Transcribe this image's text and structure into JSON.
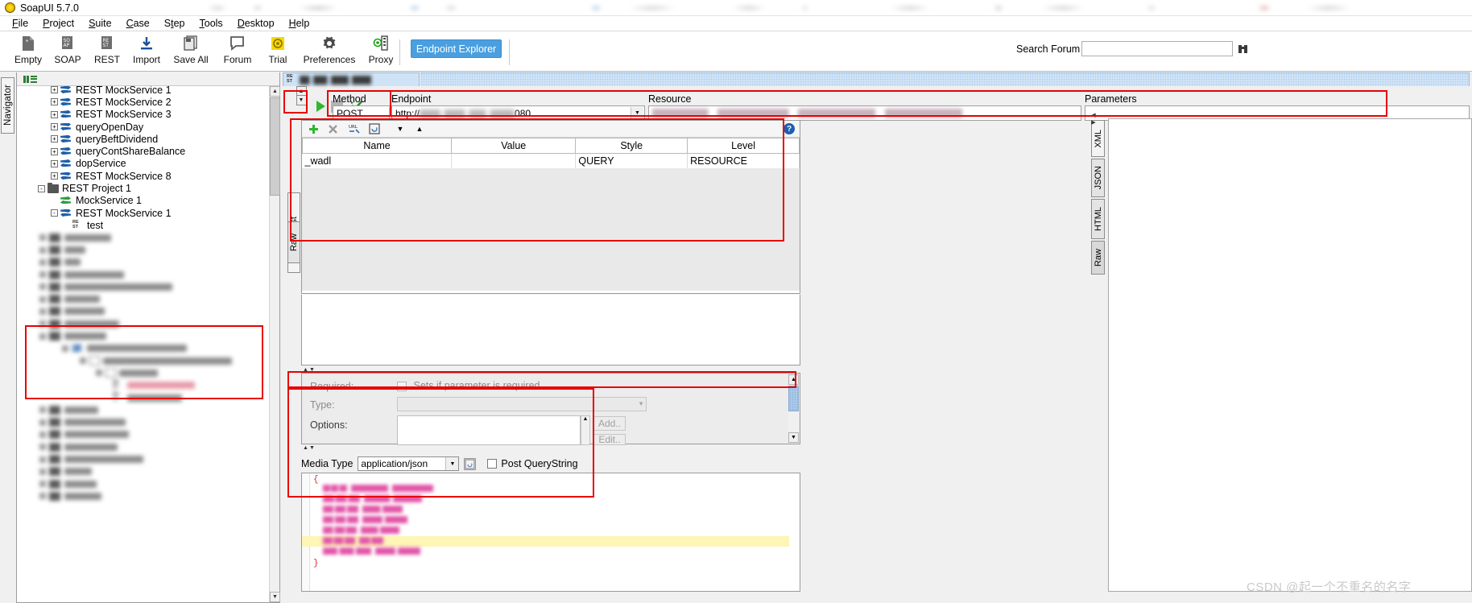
{
  "window": {
    "title": "SoapUI 5.7.0",
    "logo_icon": "soapui-logo-icon"
  },
  "menubar": {
    "items": [
      {
        "label": "File"
      },
      {
        "label": "Project"
      },
      {
        "label": "Suite"
      },
      {
        "label": "Case"
      },
      {
        "label": "Step"
      },
      {
        "label": "Tools"
      },
      {
        "label": "Desktop"
      },
      {
        "label": "Help"
      }
    ]
  },
  "toolbar": {
    "buttons": [
      {
        "label": "Empty",
        "icon": "empty-document-icon"
      },
      {
        "label": "SOAP",
        "icon": "soap-project-icon"
      },
      {
        "label": "REST",
        "icon": "rest-project-icon"
      },
      {
        "label": "Import",
        "icon": "import-download-icon"
      },
      {
        "label": "Save All",
        "icon": "save-all-icon"
      },
      {
        "label": "Forum",
        "icon": "forum-chat-icon"
      },
      {
        "label": "Trial",
        "icon": "trial-badge-icon"
      },
      {
        "label": "Preferences",
        "icon": "gear-icon"
      },
      {
        "label": "Proxy",
        "icon": "proxy-server-icon"
      }
    ],
    "endpoint_explorer": "Endpoint Explorer",
    "search_forum_label": "Search Forum",
    "search_forum_value": "",
    "search_forum_placeholder": "",
    "search_forum_icon": "binoculars-icon"
  },
  "navigator": {
    "tab_label": "Navigator",
    "header_icon": "properties-list-icon",
    "tree": [
      {
        "label": "REST MockService 1",
        "icon": "mockservice-icon",
        "indent": 2,
        "expander": "+",
        "clipped": true
      },
      {
        "label": "REST MockService 2",
        "icon": "mockservice-icon",
        "indent": 2,
        "expander": "+"
      },
      {
        "label": "REST MockService 3",
        "icon": "mockservice-icon",
        "indent": 2,
        "expander": "+"
      },
      {
        "label": "queryOpenDay",
        "icon": "mockservice-icon",
        "indent": 2,
        "expander": "+"
      },
      {
        "label": "queryBeftDividend",
        "icon": "mockservice-icon",
        "indent": 2,
        "expander": "+"
      },
      {
        "label": "queryContShareBalance",
        "icon": "mockservice-icon",
        "indent": 2,
        "expander": "+"
      },
      {
        "label": "dopService",
        "icon": "mockservice-icon",
        "indent": 2,
        "expander": "+"
      },
      {
        "label": "REST MockService 8",
        "icon": "mockservice-icon",
        "indent": 2,
        "expander": "+"
      },
      {
        "label": "REST Project 1",
        "icon": "folder-icon",
        "indent": 1,
        "expander": "-"
      },
      {
        "label": "MockService 1",
        "icon": "mockservice-green-icon",
        "indent": 2,
        "expander": ""
      },
      {
        "label": "REST MockService 1",
        "icon": "mockservice-icon",
        "indent": 2,
        "expander": "-"
      },
      {
        "label": "test",
        "icon": "rest-request-icon",
        "indent": 3,
        "expander": ""
      }
    ],
    "blurred_rows": 14,
    "scrollbar": {
      "up_icon": "chevron-up-icon",
      "down_icon": "chevron-down-icon"
    }
  },
  "request_tab": {
    "icon": "rest-icon",
    "title_blurred": true
  },
  "request": {
    "run_button_icon": "play-triangle-icon",
    "stop_button_icon": "stop-square-icon",
    "validate_icon": "green-check-icon",
    "method_label": "Method",
    "method_value": "POST",
    "endpoint_label": "Endpoint",
    "endpoint_prefix": "http://",
    "endpoint_suffix": "080",
    "endpoint_blurred": true,
    "resource_label": "Resource",
    "resource_blurred": true,
    "parameters_label": "Parameters"
  },
  "params_panel": {
    "vertical_tabs": [
      {
        "label": "Request",
        "selected": true
      },
      {
        "label": "Raw",
        "selected": false
      }
    ],
    "toolbar_icons": [
      {
        "name": "add-parameter-icon",
        "glyph": "+"
      },
      {
        "name": "remove-parameter-icon",
        "glyph": "✕"
      },
      {
        "name": "url-encode-icon",
        "glyph": "URL"
      },
      {
        "name": "refresh-icon",
        "glyph": "↻"
      },
      {
        "name": "move-down-icon",
        "glyph": "▼"
      },
      {
        "name": "move-up-icon",
        "glyph": "▲"
      },
      {
        "name": "help-icon",
        "glyph": "?"
      }
    ],
    "columns": [
      "Name",
      "Value",
      "Style",
      "Level"
    ],
    "rows": [
      {
        "name": "_wadl",
        "value": "",
        "style": "QUERY",
        "level": "RESOURCE"
      }
    ]
  },
  "properties": {
    "required_label": "Required:",
    "required_checkbox_text": "Sets if parameter is required",
    "required_checked": false,
    "type_label": "Type:",
    "type_value": "",
    "options_label": "Options:",
    "options_value": "",
    "add_button": "Add..",
    "edit_button": "Edit.."
  },
  "body": {
    "media_type_label": "Media Type",
    "media_type_value": "application/json",
    "post_querystring_label": "Post QueryString",
    "post_querystring_checked": false,
    "attachment_icon": "attachment-icon",
    "content_lines": [
      {
        "text": "{",
        "blurred": false,
        "highlight": false
      },
      {
        "text": "\"clden\"",
        "blurred": true,
        "highlight": false,
        "suffix": "16\","
      },
      {
        "text": "\"portCode\"",
        "blurred": true,
        "highlight": false
      },
      {
        "text": "\"tradeType\"",
        "blurred": true,
        "highlight": false
      },
      {
        "text": "\"tradeDate\"",
        "blurred": true,
        "highlight": false
      },
      {
        "text": "\"setCaType\"",
        "blurred": true,
        "highlight": false
      },
      {
        "text": "\"qdMoney\"",
        "blurred": true,
        "highlight": true
      },
      {
        "text": "\"cCashFlowCode\"",
        "blurred": true,
        "highlight": false
      },
      {
        "text": "}",
        "blurred": false,
        "highlight": false
      }
    ]
  },
  "response": {
    "vertical_tabs": [
      {
        "label": "XML",
        "selected": false
      },
      {
        "label": "JSON",
        "selected": false
      },
      {
        "label": "HTML",
        "selected": false
      },
      {
        "label": "Raw",
        "selected": true
      }
    ]
  },
  "watermark": "CSDN @起一个不重名的名字",
  "colors": {
    "accent_blue": "#4a9fe0",
    "highlight_red": "#e80000",
    "tab_blue": "#cfe3f7",
    "json_pink": "#e255a8",
    "highlight_yellow": "#fdf6b5"
  }
}
